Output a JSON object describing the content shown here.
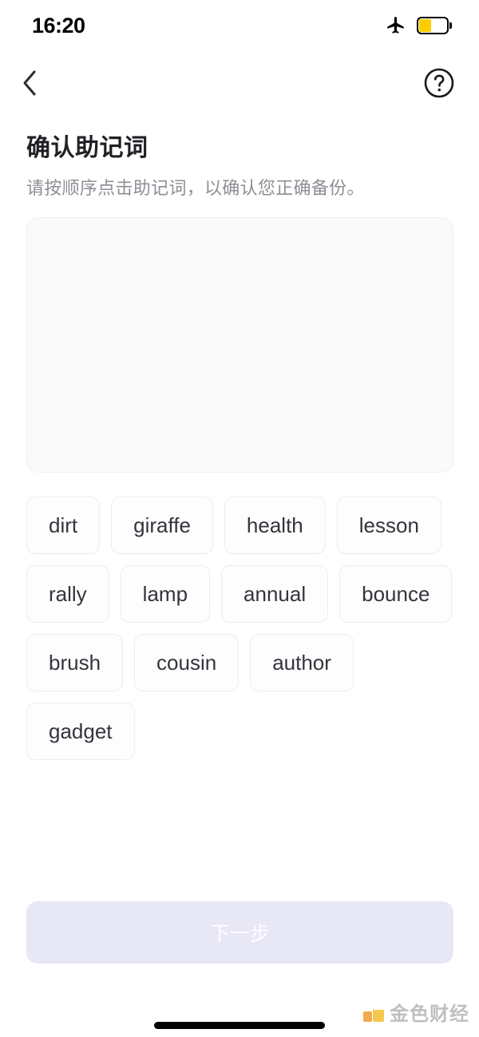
{
  "status_bar": {
    "time": "16:20",
    "airplane_icon": "airplane-mode-icon",
    "battery_icon": "battery-low-power-icon",
    "battery_color": "#FFCC00",
    "battery_level_percent": 40
  },
  "nav": {
    "back_icon": "chevron-left-icon",
    "help_icon": "question-circle-icon"
  },
  "heading": {
    "title": "确认助记词",
    "subtitle": "请按顺序点击助记词，以确认您正确备份。"
  },
  "answer_panel": {
    "selected_words": [],
    "placeholder": ""
  },
  "word_bank": {
    "words": [
      "dirt",
      "giraffe",
      "health",
      "lesson",
      "rally",
      "lamp",
      "annual",
      "bounce",
      "brush",
      "cousin",
      "author",
      "gadget"
    ]
  },
  "footer": {
    "next_label": "下一步",
    "next_disabled": true,
    "next_bg_color": "#e7e7f6",
    "next_text_color": "#ffffff"
  },
  "watermark": {
    "text": "金色财经",
    "logo_color": "#F5C33C"
  }
}
